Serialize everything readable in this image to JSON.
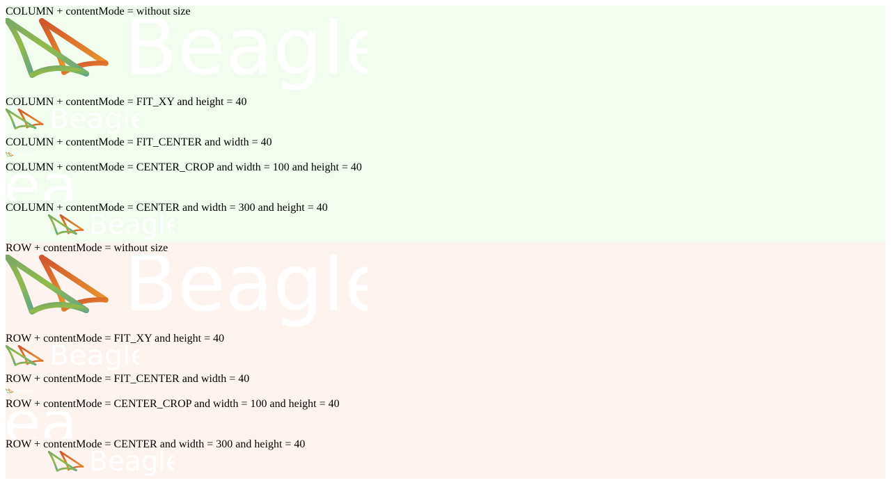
{
  "brand": {
    "wordmark": "Beagle",
    "wordmark_color": "#ffffff",
    "sail_colors": {
      "green": "#8ab54f",
      "teal": "#63a387",
      "orange": "#e0892f",
      "red": "#d45a2a"
    }
  },
  "sections": [
    {
      "direction": "COLUMN",
      "background": "#f2fdf0",
      "labels": {
        "without_size": "COLUMN + contentMode = without size",
        "fit_xy": "COLUMN + contentMode = FIT_XY and height = 40",
        "fit_center": "COLUMN + contentMode = FIT_CENTER and width = 40",
        "center_crop": "COLUMN + contentMode = CENTER_CROP and width = 100 and height = 40",
        "center": "COLUMN + contentMode = CENTER and width = 300 and height = 40"
      }
    },
    {
      "direction": "ROW",
      "background": "#fdf4ef",
      "labels": {
        "without_size": "ROW + contentMode = without size",
        "fit_xy": "ROW + contentMode = FIT_XY and height = 40",
        "fit_center": "ROW + contentMode = FIT_CENTER and width = 40",
        "center_crop": "ROW + contentMode = CENTER_CROP and width = 100 and height = 40",
        "center": "ROW + contentMode = CENTER and width = 300 and height = 40"
      }
    }
  ]
}
